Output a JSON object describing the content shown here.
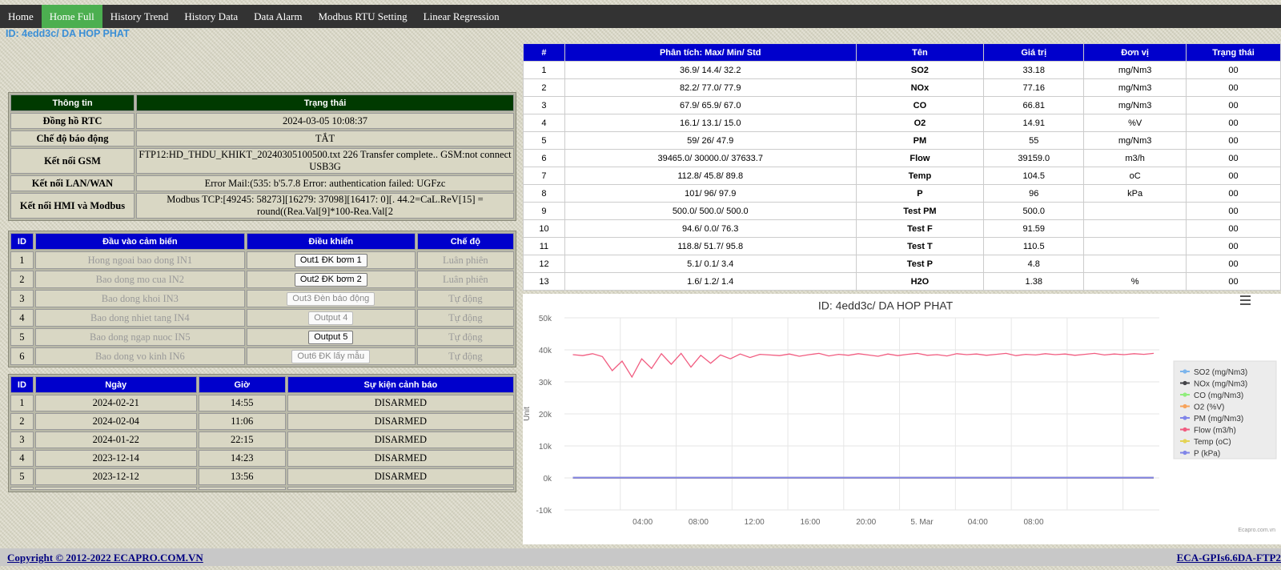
{
  "nav": [
    "Home",
    "Home Full",
    "History Trend",
    "History Data",
    "Data Alarm",
    "Modbus RTU Setting",
    "Linear Regression"
  ],
  "nav_active": 1,
  "station_id": "ID: 4edd3c/ DA HOP PHAT",
  "info": {
    "headers": [
      "Thông tin",
      "Trạng thái"
    ],
    "rows": [
      {
        "key": "Đồng hồ RTC",
        "value": "2024-03-05 10:08:37"
      },
      {
        "key": "Chế độ báo động",
        "value": "TẮT"
      },
      {
        "key": "Kết nối GSM",
        "value": "FTP12:HD_THDU_KHIKT_20240305100500.txt 226 Transfer complete.. GSM:not connect USB3G"
      },
      {
        "key": "Kết nối LAN/WAN",
        "value": "Error Mail:(535: b'5.7.8 Error: authentication failed: UGFzc"
      },
      {
        "key": "Kết nối HMI và Modbus",
        "value": "Modbus TCP:[49245: 58273][16279: 37098][16417: 0][. 44.2=CaL.ReV[15] = round((Rea.Val[9]*100-Rea.Val[2"
      }
    ]
  },
  "io": {
    "headers": [
      "ID",
      "Đầu vào cảm biến",
      "Điều khiển",
      "Chế độ"
    ],
    "rows": [
      {
        "id": "1",
        "sensor": "Hong ngoai bao dong IN1",
        "control": "Out1 ĐK bơm 1",
        "mode": "Luân phiên",
        "enabled": true
      },
      {
        "id": "2",
        "sensor": "Bao dong mo cua IN2",
        "control": "Out2 ĐK bơm 2",
        "mode": "Luân phiên",
        "enabled": true
      },
      {
        "id": "3",
        "sensor": "Bao dong khoi IN3",
        "control": "Out3 Đèn báo động",
        "mode": "Tự động",
        "enabled": false
      },
      {
        "id": "4",
        "sensor": "Bao dong nhiet tang IN4",
        "control": "Output 4",
        "mode": "Tự động",
        "enabled": false
      },
      {
        "id": "5",
        "sensor": "Bao dong ngap nuoc IN5",
        "control": "Output 5",
        "mode": "Tự động",
        "enabled": true
      },
      {
        "id": "6",
        "sensor": "Bao dong vo kinh IN6",
        "control": "Out6 ĐK lấy mẫu",
        "mode": "Tự động",
        "enabled": false
      }
    ]
  },
  "events": {
    "headers": [
      "ID",
      "Ngày",
      "Giờ",
      "Sự kiện cảnh báo"
    ],
    "rows": [
      {
        "id": "1",
        "date": "2024-02-21",
        "time": "14:55",
        "event": "DISARMED"
      },
      {
        "id": "2",
        "date": "2024-02-04",
        "time": "11:06",
        "event": "DISARMED"
      },
      {
        "id": "3",
        "date": "2024-01-22",
        "time": "22:15",
        "event": "DISARMED"
      },
      {
        "id": "4",
        "date": "2023-12-14",
        "time": "14:23",
        "event": "DISARMED"
      },
      {
        "id": "5",
        "date": "2023-12-12",
        "time": "13:56",
        "event": "DISARMED"
      }
    ]
  },
  "analysis": {
    "headers": [
      "#",
      "Phân tích: Max/ Min/ Std",
      "Tên",
      "Giá trị",
      "Đơn vị",
      "Trạng thái"
    ],
    "rows": [
      {
        "n": "1",
        "stats": "36.9/ 14.4/ 32.2",
        "name": "SO2",
        "value": "33.18",
        "unit": "mg/Nm3",
        "status": "00"
      },
      {
        "n": "2",
        "stats": "82.2/ 77.0/ 77.9",
        "name": "NOx",
        "value": "77.16",
        "unit": "mg/Nm3",
        "status": "00"
      },
      {
        "n": "3",
        "stats": "67.9/ 65.9/ 67.0",
        "name": "CO",
        "value": "66.81",
        "unit": "mg/Nm3",
        "status": "00"
      },
      {
        "n": "4",
        "stats": "16.1/ 13.1/ 15.0",
        "name": "O2",
        "value": "14.91",
        "unit": "%V",
        "status": "00"
      },
      {
        "n": "5",
        "stats": "59/ 26/ 47.9",
        "name": "PM",
        "value": "55",
        "unit": "mg/Nm3",
        "status": "00"
      },
      {
        "n": "6",
        "stats": "39465.0/ 30000.0/ 37633.7",
        "name": "Flow",
        "value": "39159.0",
        "unit": "m3/h",
        "status": "00"
      },
      {
        "n": "7",
        "stats": "112.8/ 45.8/ 89.8",
        "name": "Temp",
        "value": "104.5",
        "unit": "oC",
        "status": "00"
      },
      {
        "n": "8",
        "stats": "101/ 96/ 97.9",
        "name": "P",
        "value": "96",
        "unit": "kPa",
        "status": "00"
      },
      {
        "n": "9",
        "stats": "500.0/ 500.0/ 500.0",
        "name": "Test PM",
        "value": "500.0",
        "unit": "",
        "status": "00"
      },
      {
        "n": "10",
        "stats": "94.6/ 0.0/ 76.3",
        "name": "Test F",
        "value": "91.59",
        "unit": "",
        "status": "00"
      },
      {
        "n": "11",
        "stats": "118.8/ 51.7/ 95.8",
        "name": "Test T",
        "value": "110.5",
        "unit": "",
        "status": "00"
      },
      {
        "n": "12",
        "stats": "5.1/ 0.1/ 3.4",
        "name": "Test P",
        "value": "4.8",
        "unit": "",
        "status": "00"
      },
      {
        "n": "13",
        "stats": "1.6/ 1.2/ 1.4",
        "name": "H2O",
        "value": "1.38",
        "unit": "%",
        "status": "00"
      }
    ]
  },
  "chart_data": {
    "type": "line",
    "title": "ID: 4edd3c/ DA HOP PHAT",
    "ylabel": "Unit",
    "ylim": [
      -10000,
      50000
    ],
    "yticks": [
      "-10k",
      "0k",
      "10k",
      "20k",
      "30k",
      "40k",
      "50k"
    ],
    "ytick_values": [
      -10000,
      0,
      10000,
      20000,
      30000,
      40000,
      50000
    ],
    "xlim": [
      0,
      21.3
    ],
    "xtick_hours": [
      2,
      4,
      6,
      8,
      10,
      12,
      14,
      16,
      18,
      20
    ],
    "xticks": [
      "04:00",
      "08:00",
      "12:00",
      "16:00",
      "20:00",
      "5. Mar",
      "04:00",
      "08:00"
    ],
    "xticks_at_hours": [
      2.8,
      4.8,
      6.8,
      8.8,
      10.8,
      12.8,
      14.8,
      16.8
    ],
    "legend_position": "right",
    "credit": "Ecapro.com.vn",
    "series": [
      {
        "name": "SO2 (mg/Nm3)",
        "color": "#7cb5ec",
        "values": [
          33,
          33,
          34,
          32,
          33,
          33,
          34,
          33,
          33,
          33
        ]
      },
      {
        "name": "NOx (mg/Nm3)",
        "color": "#434348",
        "values": [
          78,
          77,
          78,
          77,
          78,
          77,
          78,
          77,
          78,
          77
        ]
      },
      {
        "name": "CO (mg/Nm3)",
        "color": "#90ed7d",
        "values": [
          67,
          66,
          67,
          67,
          66,
          67,
          67,
          66,
          67,
          67
        ]
      },
      {
        "name": "O2 (%V)",
        "color": "#f7a35c",
        "values": [
          15,
          15,
          15,
          15,
          15,
          15,
          15,
          15,
          15,
          15
        ]
      },
      {
        "name": "PM (mg/Nm3)",
        "color": "#8085e9",
        "values": [
          48,
          47,
          48,
          48,
          47,
          48,
          48,
          47,
          48,
          48
        ]
      },
      {
        "name": "Flow (m3/h)",
        "color": "#f15c80",
        "values": [
          38500,
          38200,
          38800,
          37900,
          33500,
          36500,
          31500,
          37200,
          34200,
          38800,
          35500,
          38900,
          34600,
          38300,
          35800,
          38400,
          37200,
          38700,
          37600,
          38600,
          38400,
          38200,
          38700,
          38000,
          38500,
          38900,
          38100,
          38600,
          38300,
          38800,
          38400,
          38000,
          38700,
          38200,
          38600,
          38900,
          38300,
          38500,
          38100,
          38800,
          38500,
          38700,
          38300,
          38600,
          38900,
          38200,
          38600,
          38400,
          38800,
          38500,
          38700,
          38300,
          38600,
          38900,
          38400,
          38700,
          38500,
          38800,
          38600,
          38900
        ]
      },
      {
        "name": "Temp (oC)",
        "color": "#e4d354",
        "values": [
          104,
          104,
          105,
          104,
          104,
          105,
          104,
          104,
          105,
          104
        ]
      },
      {
        "name": "P (kPa)",
        "color": "#8085e8",
        "values": [
          96,
          96,
          97,
          96,
          96,
          97,
          96,
          96,
          97,
          96
        ]
      }
    ]
  },
  "footer": {
    "copyright": "Copyright © 2012-2022 ECAPRO.COM.VN",
    "firmware": "ECA-GPIs6.6DA-FTP2"
  }
}
